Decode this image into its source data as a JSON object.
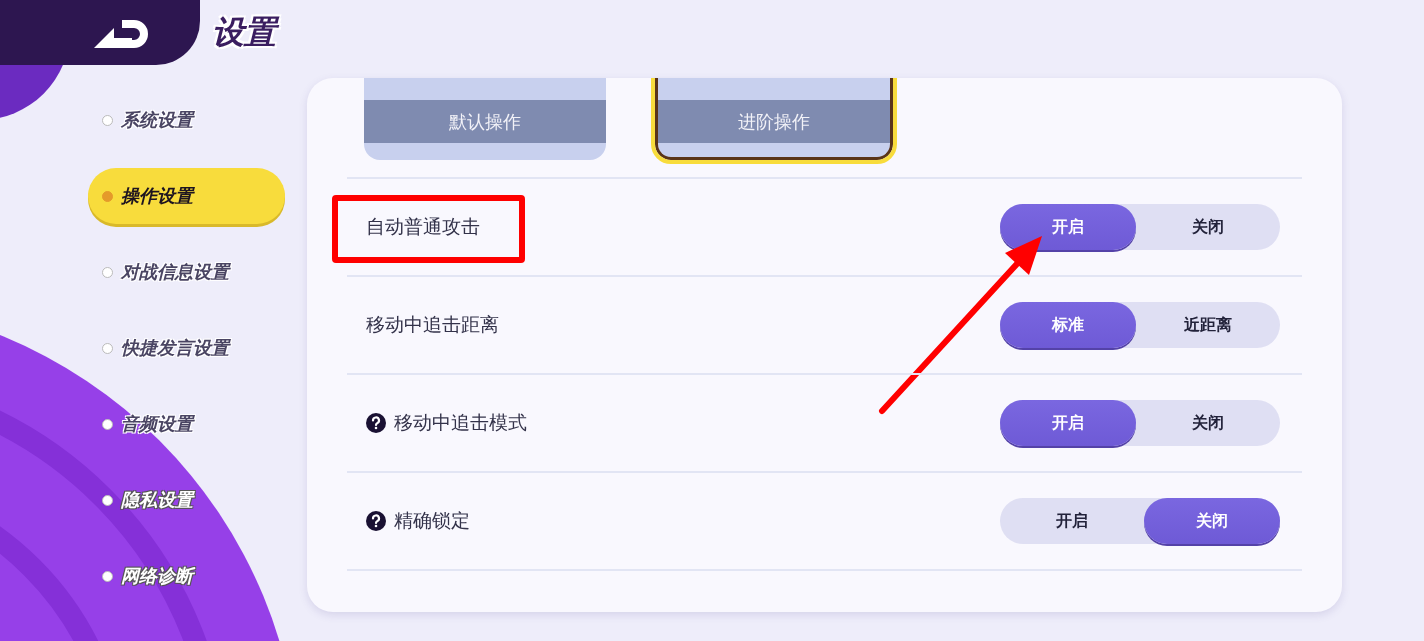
{
  "header": {
    "title": "设置"
  },
  "sidebar": {
    "items": [
      {
        "label": "系统设置",
        "selected": false
      },
      {
        "label": "操作设置",
        "selected": true
      },
      {
        "label": "对战信息设置",
        "selected": false
      },
      {
        "label": "快捷发言设置",
        "selected": false
      },
      {
        "label": "音频设置",
        "selected": false
      },
      {
        "label": "隐私设置",
        "selected": false
      },
      {
        "label": "网络诊断",
        "selected": false
      }
    ]
  },
  "modes": [
    {
      "label": "默认操作",
      "selected": false
    },
    {
      "label": "进阶操作",
      "selected": true
    }
  ],
  "rows": [
    {
      "label": "自动普通攻击",
      "help": false,
      "highlighted": true,
      "options": [
        {
          "label": "开启",
          "selected": true
        },
        {
          "label": "关闭",
          "selected": false
        }
      ]
    },
    {
      "label": "移动中追击距离",
      "help": false,
      "highlighted": false,
      "options": [
        {
          "label": "标准",
          "selected": true
        },
        {
          "label": "近距离",
          "selected": false
        }
      ]
    },
    {
      "label": "移动中追击模式",
      "help": true,
      "highlighted": false,
      "options": [
        {
          "label": "开启",
          "selected": true
        },
        {
          "label": "关闭",
          "selected": false
        }
      ]
    },
    {
      "label": "精确锁定",
      "help": true,
      "highlighted": false,
      "options": [
        {
          "label": "开启",
          "selected": false
        },
        {
          "label": "关闭",
          "selected": true
        }
      ]
    }
  ]
}
